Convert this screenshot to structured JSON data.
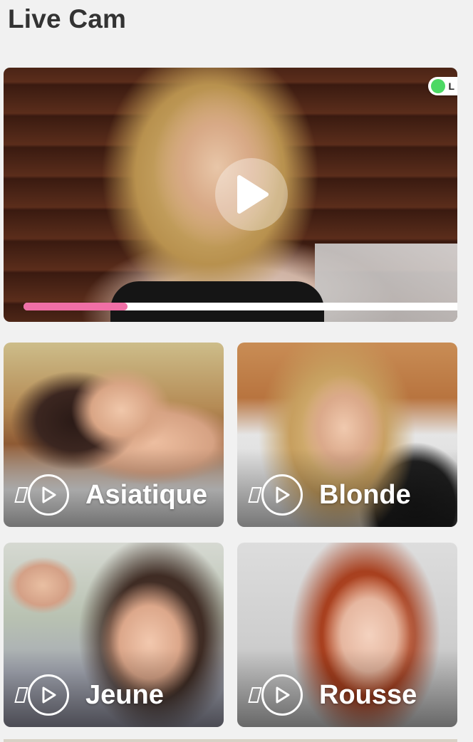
{
  "page": {
    "title": "Live Cam"
  },
  "featured": {
    "live_label": "L",
    "progress_fraction": 0.24,
    "accent_color": "#f06fa6",
    "live_color": "#4cd964",
    "play_icon": "play-icon"
  },
  "categories": [
    {
      "label": "Asiatique",
      "icon": "play-circle-icon"
    },
    {
      "label": "Blonde",
      "icon": "play-circle-icon"
    },
    {
      "label": "Jeune",
      "icon": "play-circle-icon"
    },
    {
      "label": "Rousse",
      "icon": "play-circle-icon"
    }
  ]
}
